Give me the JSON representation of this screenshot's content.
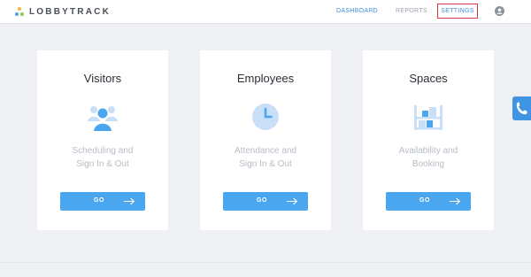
{
  "app": {
    "logo_text": "LOBBYTRACK"
  },
  "nav": {
    "dashboard": "DASHBOARD",
    "reports": "REPORTS",
    "settings": "SETTINGS"
  },
  "cards": [
    {
      "title": "Visitors",
      "desc_line1": "Scheduling and",
      "desc_line2": "Sign In & Out",
      "button": "GO",
      "icon": "people-icon"
    },
    {
      "title": "Employees",
      "desc_line1": "Attendance and",
      "desc_line2": "Sign In & Out",
      "button": "GO",
      "icon": "clock-icon"
    },
    {
      "title": "Spaces",
      "desc_line1": "Availability and",
      "desc_line2": "Booking",
      "button": "GO",
      "icon": "shelves-icon"
    }
  ],
  "colors": {
    "accent": "#4aa6ee",
    "nav_active": "#3f8fde",
    "highlight_border": "#d9373f"
  }
}
